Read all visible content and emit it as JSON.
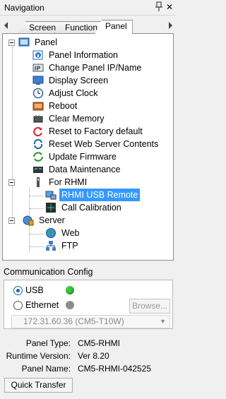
{
  "window": {
    "title": "Navigation",
    "close_glyph": "✕"
  },
  "tabs": [
    {
      "label": "Screen",
      "active": false
    },
    {
      "label": "Function",
      "active": false
    },
    {
      "label": "Panel",
      "active": true
    }
  ],
  "tree": {
    "root": "Panel",
    "items": [
      {
        "label": "Panel Information",
        "icon": "panel-info-icon"
      },
      {
        "label": "Change Panel IP/Name",
        "icon": "ip-icon"
      },
      {
        "label": "Display Screen",
        "icon": "display-screen-icon"
      },
      {
        "label": "Adjust Clock",
        "icon": "clock-icon"
      },
      {
        "label": "Reboot",
        "icon": "reboot-icon"
      },
      {
        "label": "Clear Memory",
        "icon": "clear-memory-icon"
      },
      {
        "label": "Reset to Factory default",
        "icon": "reset-icon"
      },
      {
        "label": "Reset Web Server Contents",
        "icon": "web-reset-icon"
      },
      {
        "label": "Update Firmware",
        "icon": "update-icon"
      },
      {
        "label": "Data Maintenance",
        "icon": "data-maintenance-icon"
      }
    ],
    "rhmi": {
      "label": "For RHMI",
      "children": [
        {
          "label": "RHMI USB Remote",
          "selected": true
        },
        {
          "label": "Call Calibration",
          "selected": false
        }
      ]
    },
    "server": {
      "label": "Server",
      "children": [
        {
          "label": "Web"
        },
        {
          "label": "FTP"
        }
      ]
    }
  },
  "comm": {
    "title": "Communication Config",
    "usb_label": "USB",
    "ethernet_label": "Ethernet",
    "selected": "USB",
    "usb_status_color": "#3cc83c",
    "ethernet_status_color": "#8c8c8c",
    "browse_label": "Browse...",
    "ip_value": "172.31.60.36 (CM5-T10W)"
  },
  "panel_info": {
    "type_key": "Panel Type:",
    "type_val": "CM5-RHMI",
    "runtime_key": "Runtime Version:",
    "runtime_val": "Ver 8.20",
    "name_key": "Panel Name:",
    "name_val": "CM5-RHMI-042525"
  },
  "quick_transfer_label": "Quick Transfer"
}
